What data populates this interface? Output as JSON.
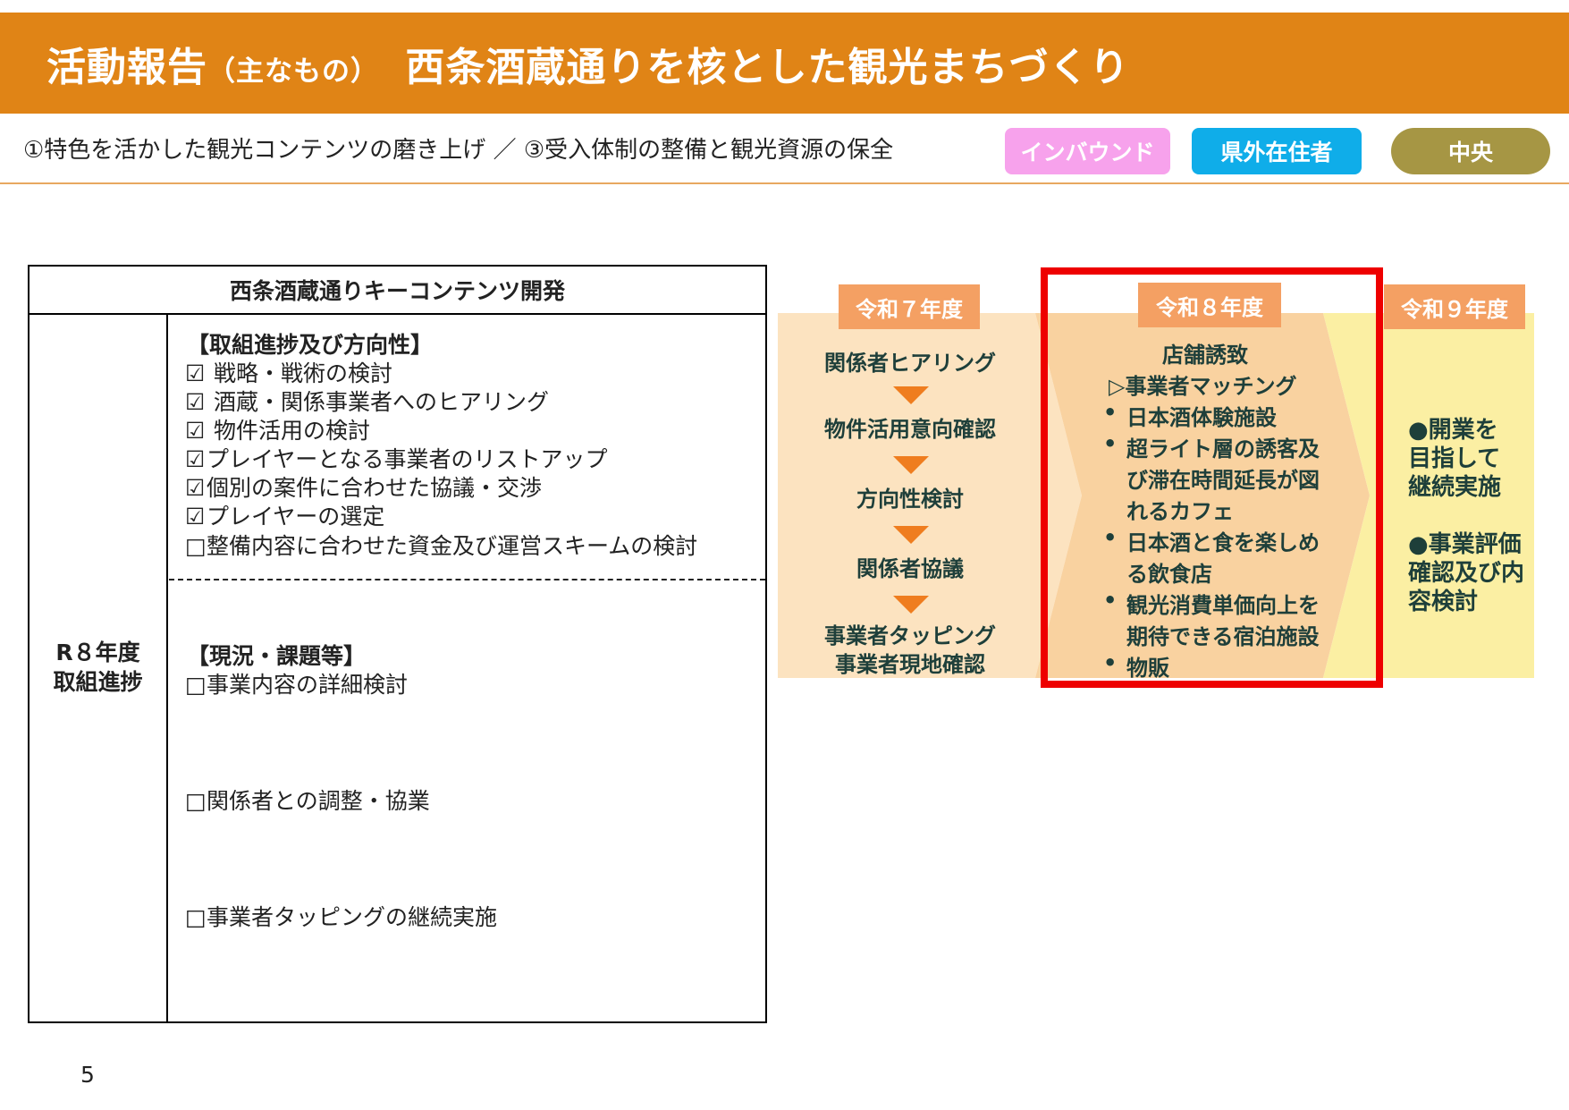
{
  "header": {
    "title_main": "活動報告",
    "title_sub": "（主なもの）",
    "title_topic": "西条酒蔵通りを核とした観光まちづくり",
    "color": "#E08416"
  },
  "subheader": {
    "text": "①特色を活かした観光コンテンツの磨き上げ ／ ③受入体制の整備と観光資源の保全",
    "tags": [
      {
        "label": "インバウンド",
        "color": "#F7A2EC"
      },
      {
        "label": "県外在住者",
        "color": "#0FADE9"
      },
      {
        "label": "中央",
        "color": "#A69644"
      }
    ]
  },
  "table": {
    "header": "西条酒蔵通りキーコンテンツ開発",
    "row_label_line1": "R８年度",
    "row_label_line2": "取組進捗",
    "progress_title": "【取組進捗及び方向性】",
    "progress_items": [
      {
        "mark": "☑",
        "text": " 戦略・戦術の検討"
      },
      {
        "mark": "☑",
        "text": " 酒蔵・関係事業者へのヒアリング"
      },
      {
        "mark": "☑",
        "text": " 物件活用の検討"
      },
      {
        "mark": "☑",
        "text": "プレイヤーとなる事業者のリストアップ"
      },
      {
        "mark": "☑",
        "text": "個別の案件に合わせた協議・交渉"
      },
      {
        "mark": "☑",
        "text": "プレイヤーの選定"
      },
      {
        "mark": "□",
        "text": "整備内容に合わせた資金及び運営スキームの検討"
      }
    ],
    "issues_title": "【現況・課題等】",
    "issues_items": [
      {
        "mark": "□",
        "text": "事業内容の詳細検討"
      },
      {
        "mark": "□",
        "text": "関係者との調整・協業"
      },
      {
        "mark": "□",
        "text": "事業者タッピングの継続実施"
      }
    ]
  },
  "timeline": {
    "r7": {
      "label": "令和７年度",
      "steps": [
        "関係者ヒアリング",
        "物件活用意向確認",
        "方向性検討",
        "関係者協議"
      ],
      "last_line1": "事業者タッピング",
      "last_line2": "事業者現地確認"
    },
    "r8": {
      "label": "令和８年度",
      "title": "店舗誘致",
      "subtitle": "▷事業者マッチング",
      "bullet_mark": "•",
      "lines": [
        "日本酒体験施設",
        "超ライト層の誘客及",
        "び滞在時間延長が図",
        "れるカフェ",
        "日本酒と食を楽しめ",
        "る飲食店",
        "観光消費単価向上を",
        "期待できる宿泊施設",
        "物販"
      ]
    },
    "r9": {
      "label": "令和９年度",
      "lines_a": [
        "●開業を",
        "目指して",
        "継続実施"
      ],
      "lines_b": [
        "●事業評価",
        "確認及び内",
        "容検討"
      ]
    },
    "colors": {
      "label_bg": "#F4A063",
      "arrow": "#EF7D1F",
      "highlight": "#EE0000"
    }
  },
  "page_number": "5"
}
